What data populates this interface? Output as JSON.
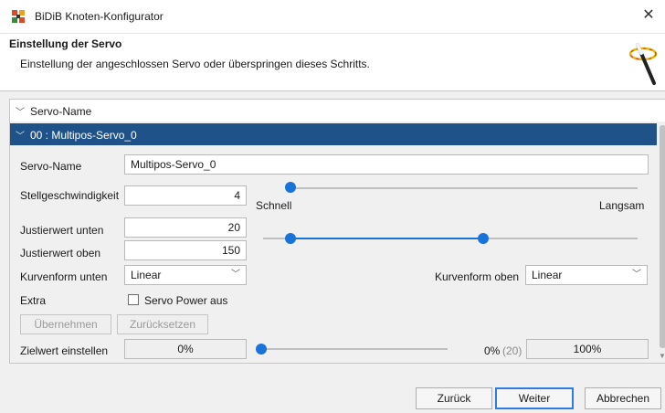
{
  "window": {
    "title": "BiDiB Knoten-Konfigurator"
  },
  "header": {
    "title": "Einstellung der Servo",
    "subtitle": "Einstellung der angeschlossen Servo oder überspringen dieses Schritts."
  },
  "tree": {
    "root_label": "Servo-Name",
    "node_label": "00 : Multipos-Servo_0"
  },
  "form": {
    "servo_name_label": "Servo-Name",
    "servo_name_value": "Multipos-Servo_0",
    "speed_label": "Stellgeschwindigkeit",
    "speed_value": "4",
    "speed_slider": {
      "min_label": "Schnell",
      "max_label": "Langsam",
      "level": 0
    },
    "adjust_low_label": "Justierwert unten",
    "adjust_low_value": "20",
    "adjust_high_label": "Justierwert oben",
    "adjust_high_value": "150",
    "range_slider": {
      "low_fraction": 0.13,
      "high_fraction": 0.64
    },
    "curve_low_label": "Kurvenform unten",
    "curve_low_value": "Linear",
    "curve_high_label": "Kurvenform oben",
    "curve_high_value": "Linear",
    "extra_label": "Extra",
    "power_off_label": "Servo Power aus",
    "power_off_checked": false,
    "apply_label": "Übernehmen",
    "reset_label": "Zurücksetzen",
    "target_label": "Zielwert einstellen",
    "target_value_left": "0%",
    "target_percent": "0%",
    "target_raw": "(20)",
    "target_value_right": "100%",
    "target_slider_level": 0
  },
  "footer": {
    "back_label": "Zurück",
    "next_label": "Weiter",
    "cancel_label": "Abbrechen"
  },
  "colors": {
    "accent": "#1a73d9",
    "selection": "#1f5289"
  }
}
